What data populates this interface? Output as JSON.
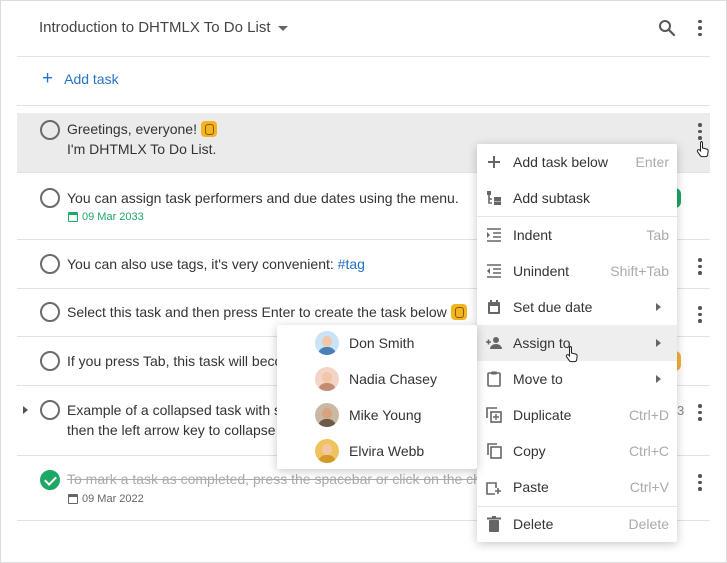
{
  "header": {
    "title": "Introduction to DHTMLX To Do List"
  },
  "add_task": {
    "label": "Add task"
  },
  "tasks": [
    {
      "line1": "Greetings, everyone!",
      "line2": "I'm DHTMLX To Do List."
    },
    {
      "text": "You can assign task performers and due dates using the menu.",
      "due": "09 Mar 2033"
    },
    {
      "text": "You can also use tags, it's very convenient: ",
      "tag": "#tag"
    },
    {
      "text": "Select this task and then press Enter to create the task below"
    },
    {
      "text": "If you press Tab, this task will beco"
    },
    {
      "line1": "Example of a collapsed task with s",
      "line2": "then the left arrow key to collapse",
      "count": "3"
    },
    {
      "text": "To mark a task as completed, press the spacebar or click on the ch",
      "due": "09 Mar 2022"
    }
  ],
  "context_menu": {
    "items": [
      {
        "label": "Add task below",
        "shortcut": "Enter",
        "icon": "plus-icon"
      },
      {
        "label": "Add subtask",
        "shortcut": "",
        "icon": "subtask-icon"
      },
      {
        "label": "Indent",
        "shortcut": "Tab",
        "icon": "indent-icon"
      },
      {
        "label": "Unindent",
        "shortcut": "Shift+Tab",
        "icon": "unindent-icon"
      },
      {
        "label": "Set due date",
        "shortcut": "",
        "icon": "calendar-icon"
      },
      {
        "label": "Assign to",
        "shortcut": "",
        "icon": "people-icon"
      },
      {
        "label": "Move to",
        "shortcut": "",
        "icon": "clipboard-icon"
      },
      {
        "label": "Duplicate",
        "shortcut": "Ctrl+D",
        "icon": "duplicate-icon"
      },
      {
        "label": "Copy",
        "shortcut": "Ctrl+C",
        "icon": "copy-icon"
      },
      {
        "label": "Paste",
        "shortcut": "Ctrl+V",
        "icon": "paste-icon"
      },
      {
        "label": "Delete",
        "shortcut": "Delete",
        "icon": "trash-icon"
      }
    ]
  },
  "assign_menu": {
    "people": [
      {
        "name": "Don Smith"
      },
      {
        "name": "Nadia Chasey"
      },
      {
        "name": "Mike Young"
      },
      {
        "name": "Elvira Webb"
      }
    ]
  },
  "colors": {
    "accent": "#2473c8",
    "done": "#1ea765",
    "selected_bg": "#ebebeb"
  }
}
